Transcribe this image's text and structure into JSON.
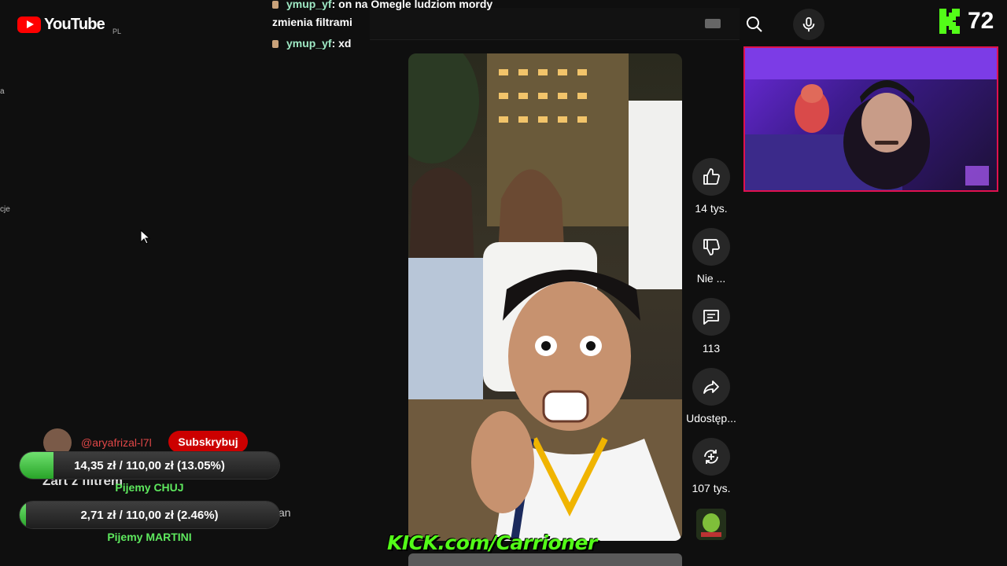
{
  "header": {
    "logo_text": "YouTube",
    "region": "PL"
  },
  "sidebar_fragments": [
    "a",
    "cje"
  ],
  "chat": [
    {
      "user": "ymup_yf",
      "sep": ": ",
      "message": "on na Omegle ludziom mordy"
    },
    {
      "user": "",
      "sep": "",
      "message": "zmienia filtrami"
    },
    {
      "user": "ymup_yf",
      "sep": ": ",
      "message": "xd"
    }
  ],
  "kick_viewers": "72",
  "actions": {
    "like": {
      "label": "14 tys.",
      "icon": "thumb-up-icon"
    },
    "dislike": {
      "label": "Nie ...",
      "icon": "thumb-down-icon"
    },
    "comments": {
      "label": "113",
      "icon": "comment-icon"
    },
    "share": {
      "label": "Udostęp...",
      "icon": "share-icon"
    },
    "remix": {
      "label": "107 tys.",
      "icon": "remix-icon"
    }
  },
  "channel": {
    "handle": "@aryafrizal-l7l",
    "subscribe_label": "Subskrybuj",
    "title_fragment": "Żart z filtrem",
    "trailing_fragment": "an"
  },
  "goals": [
    {
      "text": "14,35 zł / 110,00 zł (13.05%)",
      "percent": 13.05,
      "label": "Pijemy CHUJ"
    },
    {
      "text": "2,71 zł / 110,00 zł (2.46%)",
      "percent": 2.46,
      "label": "Pijemy MARTINI"
    }
  ],
  "kick_banner": "KICK.com/Carrioner",
  "colors": {
    "youtube_red": "#ff0000",
    "kick_green": "#53fc18",
    "goal_green": "#28a428",
    "webcam_border": "#e0114f"
  }
}
